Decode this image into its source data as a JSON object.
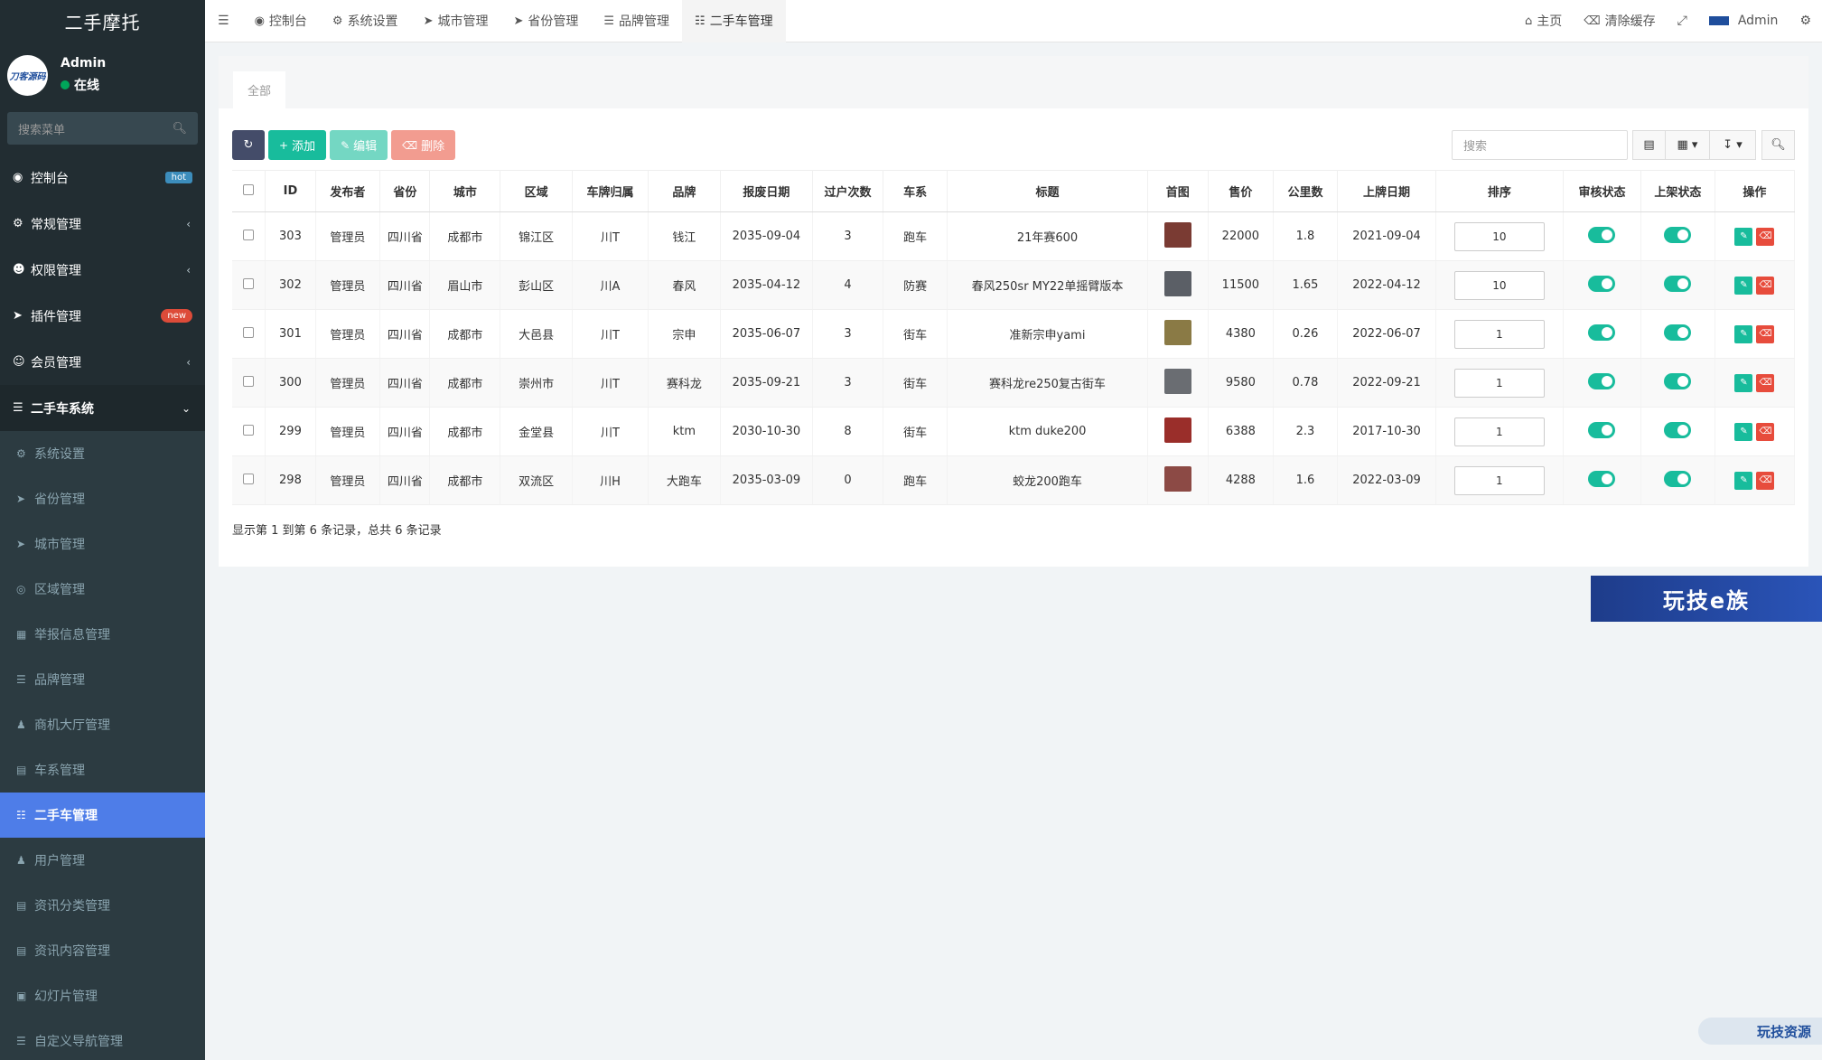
{
  "sidebar": {
    "brand": "二手摩托",
    "avatar_text": "刀客源码",
    "user_name": "Admin",
    "user_status": "在线",
    "search_placeholder": "搜索菜单",
    "menu": [
      {
        "label": "控制台",
        "badge": "hot",
        "icon": "dashboard-icon"
      },
      {
        "label": "常规管理",
        "icon": "cogs-icon"
      },
      {
        "label": "权限管理",
        "icon": "users-icon"
      },
      {
        "label": "插件管理",
        "badge": "new",
        "icon": "rocket-icon"
      },
      {
        "label": "会员管理",
        "icon": "user-circle-icon"
      },
      {
        "label": "二手车系统",
        "icon": "list-icon"
      }
    ],
    "submenu": [
      {
        "label": "系统设置",
        "icon": "cogs-icon"
      },
      {
        "label": "省份管理",
        "icon": "location-arrow-icon"
      },
      {
        "label": "城市管理",
        "icon": "location-arrow-icon"
      },
      {
        "label": "区域管理",
        "icon": "dot-circle-icon"
      },
      {
        "label": "举报信息管理",
        "icon": "table-icon"
      },
      {
        "label": "品牌管理",
        "icon": "bars-icon"
      },
      {
        "label": "商机大厅管理",
        "icon": "user-icon"
      },
      {
        "label": "车系管理",
        "icon": "list-alt-icon"
      },
      {
        "label": "二手车管理",
        "icon": "sitemap-icon"
      },
      {
        "label": "用户管理",
        "icon": "user-icon"
      },
      {
        "label": "资讯分类管理",
        "icon": "newspaper-icon"
      },
      {
        "label": "资讯内容管理",
        "icon": "newspaper-icon"
      },
      {
        "label": "幻灯片管理",
        "icon": "image-icon"
      },
      {
        "label": "自定义导航管理",
        "icon": "bars-icon"
      }
    ]
  },
  "topnav": {
    "tabs": [
      "控制台",
      "系统设置",
      "城市管理",
      "省份管理",
      "品牌管理",
      "二手车管理"
    ],
    "home": "主页",
    "clear_cache": "清除缓存",
    "admin": "Admin"
  },
  "panel": {
    "tab_all": "全部",
    "add": "添加",
    "edit": "编辑",
    "delete": "删除",
    "search_placeholder": "搜索",
    "footer": "显示第 1 到第 6 条记录，总共 6 条记录"
  },
  "table": {
    "headers": [
      "ID",
      "发布者",
      "省份",
      "城市",
      "区域",
      "车牌归属",
      "品牌",
      "报废日期",
      "过户次数",
      "车系",
      "标题",
      "首图",
      "售价",
      "公里数",
      "上牌日期",
      "排序",
      "审核状态",
      "上架状态",
      "操作"
    ],
    "rows": [
      {
        "id": "303",
        "publisher": "管理员",
        "province": "四川省",
        "city": "成都市",
        "district": "锦江区",
        "plate": "川T",
        "brand": "钱江",
        "scrap": "2035-09-04",
        "transfers": "3",
        "series": "跑车",
        "title": "21年赛600",
        "price": "22000",
        "km": "1.8",
        "reg": "2021-09-04",
        "sort": "10",
        "thumb_color": "#7a3b33"
      },
      {
        "id": "302",
        "publisher": "管理员",
        "province": "四川省",
        "city": "眉山市",
        "district": "彭山区",
        "plate": "川A",
        "brand": "春风",
        "scrap": "2035-04-12",
        "transfers": "4",
        "series": "防赛",
        "title": "春风250sr MY22单摇臂版本",
        "price": "11500",
        "km": "1.65",
        "reg": "2022-04-12",
        "sort": "10",
        "thumb_color": "#5b5f66"
      },
      {
        "id": "301",
        "publisher": "管理员",
        "province": "四川省",
        "city": "成都市",
        "district": "大邑县",
        "plate": "川T",
        "brand": "宗申",
        "scrap": "2035-06-07",
        "transfers": "3",
        "series": "街车",
        "title": "准新宗申yami",
        "price": "4380",
        "km": "0.26",
        "reg": "2022-06-07",
        "sort": "1",
        "thumb_color": "#8a7a45"
      },
      {
        "id": "300",
        "publisher": "管理员",
        "province": "四川省",
        "city": "成都市",
        "district": "崇州市",
        "plate": "川T",
        "brand": "赛科龙",
        "scrap": "2035-09-21",
        "transfers": "3",
        "series": "街车",
        "title": "赛科龙re250复古街车",
        "price": "9580",
        "km": "0.78",
        "reg": "2022-09-21",
        "sort": "1",
        "thumb_color": "#6a6d72"
      },
      {
        "id": "299",
        "publisher": "管理员",
        "province": "四川省",
        "city": "成都市",
        "district": "金堂县",
        "plate": "川T",
        "brand": "ktm",
        "scrap": "2030-10-30",
        "transfers": "8",
        "series": "街车",
        "title": "ktm duke200",
        "price": "6388",
        "km": "2.3",
        "reg": "2017-10-30",
        "sort": "1",
        "thumb_color": "#9a2e2a"
      },
      {
        "id": "298",
        "publisher": "管理员",
        "province": "四川省",
        "city": "成都市",
        "district": "双流区",
        "plate": "川H",
        "brand": "大跑车",
        "scrap": "2035-03-09",
        "transfers": "0",
        "series": "跑车",
        "title": "蛟龙200跑车",
        "price": "4288",
        "km": "1.6",
        "reg": "2022-03-09",
        "sort": "1",
        "thumb_color": "#8c4a45"
      }
    ]
  },
  "watermark": {
    "banner": "玩技e族",
    "corner": "玩技资源"
  },
  "colors": {
    "sidebar_bg": "#222d32",
    "active_menu": "#4e7de8",
    "success": "#18bc9c",
    "danger": "#e74c3c"
  }
}
